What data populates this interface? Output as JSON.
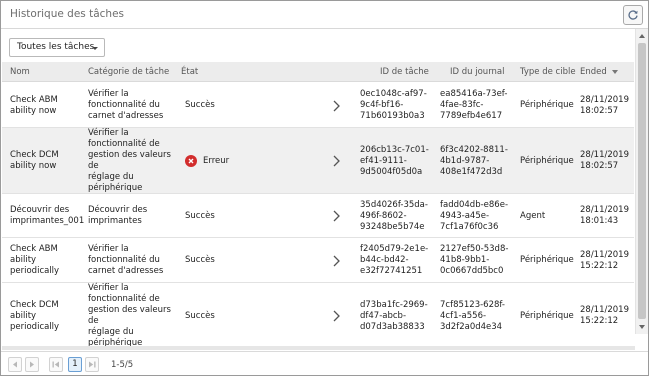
{
  "window": {
    "title": "Historique des tâches"
  },
  "toolbar": {
    "filter_value": "Toutes les tâches"
  },
  "table": {
    "headers": {
      "name": "Nom",
      "category": "Catégorie de tâche",
      "state": "État",
      "task_id": "ID de tâche",
      "journal_id": "ID du journal",
      "target_type": "Type de cible",
      "ended": "Ended"
    },
    "rows": [
      {
        "name": [
          "Check ABM",
          "ability now"
        ],
        "category": [
          "Vérifier la",
          "fonctionnalité du",
          "carnet d'adresses"
        ],
        "state": "Succès",
        "status": "success",
        "task_id": [
          "0ec1048c-af97-",
          "9c4f-bf16-",
          "71b60193b0a3"
        ],
        "journal_id": [
          "ea85416a-73ef-",
          "4fae-83fc-",
          "7789efb4e617"
        ],
        "target_type": "Périphérique",
        "ended": [
          "28/11/2019",
          "18:02:57"
        ]
      },
      {
        "name": [
          "Check DCM",
          "ability now"
        ],
        "category": [
          "Vérifier la",
          "fonctionnalité de",
          "gestion des valeurs de",
          "réglage du",
          "périphérique"
        ],
        "state": "Erreur",
        "status": "error",
        "task_id": [
          "206cb13c-7c01-",
          "ef41-9111-",
          "9d5004f05d0a"
        ],
        "journal_id": [
          "6f3c4202-8811-",
          "4b1d-9787-",
          "408e1f472d3d"
        ],
        "target_type": "Périphérique",
        "ended": [
          "28/11/2019",
          "18:02:57"
        ]
      },
      {
        "name": [
          "Découvrir des",
          "imprimantes_001"
        ],
        "category": [
          "Découvrir des",
          "imprimantes"
        ],
        "state": "Succès",
        "status": "success",
        "task_id": [
          "35d4026f-35da-",
          "496f-8602-",
          "93248be5b74e"
        ],
        "journal_id": [
          "fadd04db-e86e-",
          "4943-a45e-",
          "7cf1a76f0c36"
        ],
        "target_type": "Agent",
        "ended": [
          "28/11/2019",
          "18:01:43"
        ]
      },
      {
        "name": [
          "Check ABM",
          "ability",
          "periodically"
        ],
        "category": [
          "Vérifier la",
          "fonctionnalité du",
          "carnet d'adresses"
        ],
        "state": "Succès",
        "status": "success",
        "task_id": [
          "f2405d79-2e1e-",
          "b44c-bd42-",
          "e32f72741251"
        ],
        "journal_id": [
          "2127ef50-53d8-",
          "41b8-9bb1-",
          "0c0667dd5bc0"
        ],
        "target_type": "Périphérique",
        "ended": [
          "28/11/2019",
          "15:22:12"
        ]
      },
      {
        "name": [
          "Check DCM",
          "ability",
          "periodically"
        ],
        "category": [
          "Vérifier la",
          "fonctionnalité de",
          "gestion des valeurs de",
          "réglage du",
          "périphérique"
        ],
        "state": "Succès",
        "status": "success",
        "task_id": [
          "d73ba1fc-2969-",
          "df47-abcb-",
          "d07d3ab38833"
        ],
        "journal_id": [
          "7cf85123-628f-",
          "4cf1-a556-",
          "3d2f2a0d4e34"
        ],
        "target_type": "Périphérique",
        "ended": [
          "28/11/2019",
          "15:22:12"
        ]
      }
    ]
  },
  "pager": {
    "current_page": "1",
    "range": "1-5/5"
  },
  "colors": {
    "error": "#d22d2d",
    "selected_row": "#f0f0f0",
    "header_bg": "#ececec"
  },
  "icons": {
    "refresh": "refresh-icon",
    "error": "error-icon",
    "row_detail": "chevron-right-icon"
  }
}
